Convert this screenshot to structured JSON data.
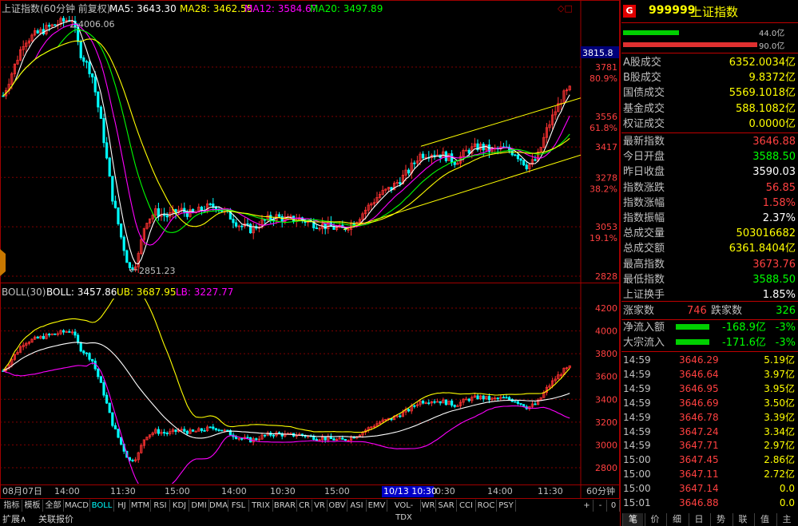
{
  "chart_title": {
    "name": "上证指数(60分钟 前复权)",
    "ma5_label": "MA5:",
    "ma5": "3643.30",
    "ma28_label": "MA28:",
    "ma28": "3462.55",
    "ma12_label": "MA12:",
    "ma12": "3584.67",
    "ma20_label": "MA20:",
    "ma20": "3497.89",
    "corner": "◇□"
  },
  "boll_title": {
    "name": "BOLL(30)",
    "boll_label": "BOLL:",
    "boll": "3457.86",
    "ub_label": "UB:",
    "ub": "3687.95",
    "lb_label": "LB:",
    "lb": "3227.77"
  },
  "annotations": {
    "high": "4006.06",
    "low": "2851.23",
    "current_tag": "3815.8"
  },
  "price_axis": [
    {
      "price": "3781",
      "pct": "80.9%"
    },
    {
      "price": "3556",
      "pct": "61.8%"
    },
    {
      "price": "3417",
      "pct": ""
    },
    {
      "price": "3278",
      "pct": "38.2%"
    },
    {
      "price": "3053",
      "pct": "19.1%"
    },
    {
      "price": "2828",
      "pct": ""
    }
  ],
  "boll_axis": [
    "4200",
    "4000",
    "3800",
    "3600",
    "3400",
    "3200",
    "3000",
    "2800"
  ],
  "time_axis": [
    "08月07日",
    "14:00",
    "11:30",
    "15:00",
    "14:00",
    "10:30",
    "15:00",
    "10/13 10:30",
    "0:30",
    "14:00",
    "11:30"
  ],
  "period_label": "60分钟",
  "zoom_controls": [
    "+",
    "-",
    "0"
  ],
  "indicator_tabs": [
    "指标",
    "模板",
    "全部",
    "MACD",
    "BOLL",
    "HJ",
    "MTM",
    "RSI",
    "KDJ",
    "DMI",
    "DMA",
    "FSL",
    "TRIX",
    "BRAR",
    "CR",
    "VR",
    "OBV",
    "ASI",
    "EMV",
    "VOL-TDX",
    "WR",
    "SAR",
    "CCI",
    "ROC",
    "PSY"
  ],
  "active_tab": "BOLL",
  "bottom_buttons": [
    "扩展∧",
    "关联报价"
  ],
  "side_panel": {
    "badge": "G",
    "code": "999999",
    "name": "上证指数",
    "bar1_value": "44.0亿",
    "bar2_value": "90.0亿",
    "turnover": [
      {
        "label": "A股成交",
        "value": "6352.0034亿"
      },
      {
        "label": "B股成交",
        "value": "9.8372亿"
      },
      {
        "label": "国债成交",
        "value": "5569.1018亿"
      },
      {
        "label": "基金成交",
        "value": "588.1082亿"
      },
      {
        "label": "权证成交",
        "value": "0.0000亿"
      }
    ],
    "quote": [
      {
        "label": "最新指数",
        "value": "3646.88",
        "color": "#ff4040"
      },
      {
        "label": "今日开盘",
        "value": "3588.50",
        "color": "#00ff00"
      },
      {
        "label": "昨日收盘",
        "value": "3590.03",
        "color": "#ffffff"
      },
      {
        "label": "指数涨跌",
        "value": "56.85",
        "color": "#ff4040"
      },
      {
        "label": "指数涨幅",
        "value": "1.58%",
        "color": "#ff4040"
      },
      {
        "label": "指数振幅",
        "value": "2.37%",
        "color": "#ffffff"
      },
      {
        "label": "总成交量",
        "value": "503016682",
        "color": "#ffff00"
      },
      {
        "label": "总成交额",
        "value": "6361.8404亿",
        "color": "#ffff00"
      },
      {
        "label": "最高指数",
        "value": "3673.76",
        "color": "#ff4040"
      },
      {
        "label": "最低指数",
        "value": "3588.50",
        "color": "#00ff00"
      },
      {
        "label": "上证换手",
        "value": "1.85%",
        "color": "#ffffff"
      }
    ],
    "updown": {
      "up_label": "涨家数",
      "up": "746",
      "down_label": "跌家数",
      "down": "326"
    },
    "flows": [
      {
        "label": "净流入额",
        "value": "-168.9亿",
        "pct": "-3%"
      },
      {
        "label": "大宗流入",
        "value": "-171.6亿",
        "pct": "-3%"
      }
    ],
    "ticks": [
      {
        "time": "14:59",
        "price": "3646.29",
        "amount": "5.19亿"
      },
      {
        "time": "14:59",
        "price": "3646.64",
        "amount": "3.97亿"
      },
      {
        "time": "14:59",
        "price": "3646.95",
        "amount": "3.95亿"
      },
      {
        "time": "14:59",
        "price": "3646.69",
        "amount": "3.50亿"
      },
      {
        "time": "14:59",
        "price": "3646.78",
        "amount": "3.39亿"
      },
      {
        "time": "14:59",
        "price": "3647.24",
        "amount": "3.34亿"
      },
      {
        "time": "14:59",
        "price": "3647.71",
        "amount": "2.97亿"
      },
      {
        "time": "15:00",
        "price": "3647.45",
        "amount": "2.86亿"
      },
      {
        "time": "15:00",
        "price": "3647.11",
        "amount": "2.72亿"
      },
      {
        "time": "15:00",
        "price": "3647.14",
        "amount": "0.0"
      },
      {
        "time": "15:01",
        "price": "3646.88",
        "amount": "0.0"
      }
    ],
    "bottom_tabs": [
      "笔",
      "价",
      "细",
      "日",
      "势",
      "联",
      "值",
      "主"
    ]
  },
  "colors": {
    "up": "#ff3232",
    "down": "#00ffff",
    "ma5": "#ffffff",
    "ma28": "#ffff00",
    "ma12": "#ff00ff",
    "ma20": "#00ff00",
    "grid": "#800000"
  }
}
